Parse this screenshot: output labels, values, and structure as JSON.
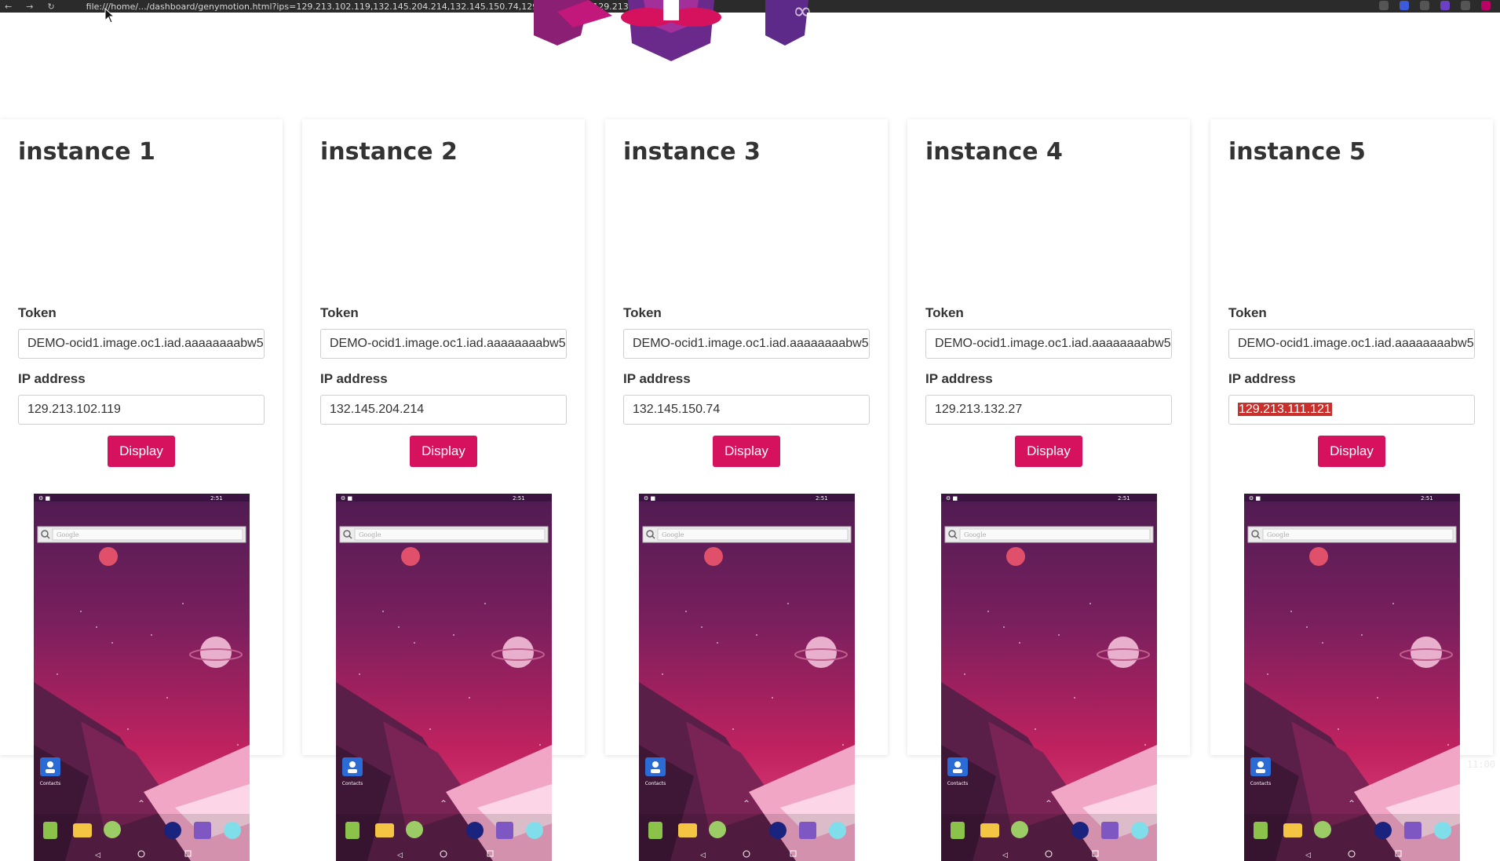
{
  "browser": {
    "url": "file:///home/.../dashboard/genymotion.html?ips=129.213.102.119,132.145.204.214,132.145.150.74,129.213.132.27,129.213.111.121"
  },
  "instances": [
    {
      "title": "instance 1",
      "token_label": "Token",
      "token": "DEMO-ocid1.image.oc1.iad.aaaaaaaabw5",
      "ip_label": "IP address",
      "ip": "129.213.102.119",
      "button": "Display"
    },
    {
      "title": "instance 2",
      "token_label": "Token",
      "token": "DEMO-ocid1.image.oc1.iad.aaaaaaaabw5",
      "ip_label": "IP address",
      "ip": "132.145.204.214",
      "button": "Display"
    },
    {
      "title": "instance 3",
      "token_label": "Token",
      "token": "DEMO-ocid1.image.oc1.iad.aaaaaaaabw5",
      "ip_label": "IP address",
      "ip": "132.145.150.74",
      "button": "Display"
    },
    {
      "title": "instance 4",
      "token_label": "Token",
      "token": "DEMO-ocid1.image.oc1.iad.aaaaaaaabw5",
      "ip_label": "IP address",
      "ip": "129.213.132.27",
      "button": "Display"
    },
    {
      "title": "instance 5",
      "token_label": "Token",
      "token": "DEMO-ocid1.image.oc1.iad.aaaaaaaabw5",
      "ip_label": "IP address",
      "ip": "129.213.111.121",
      "button": "Display",
      "ip_selected": true
    }
  ],
  "phone": {
    "time": "2:51",
    "search_placeholder": "Google",
    "app_label": "Contacts"
  },
  "colors": {
    "accent": "#d6125f",
    "selection": "#c9302c"
  },
  "clock": "11:00"
}
